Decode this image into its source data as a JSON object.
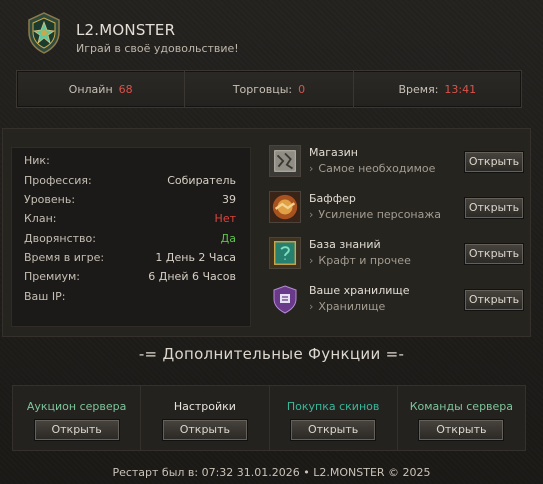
{
  "header": {
    "title": "L2.MONSTER",
    "subtitle": "Играй в своё удовольствие!"
  },
  "stats": [
    {
      "label": "Онлайн",
      "value": "68"
    },
    {
      "label": "Торговцы:",
      "value": "0"
    },
    {
      "label": "Время:",
      "value": "13:41"
    }
  ],
  "profile": {
    "rows": [
      {
        "label": "Ник:",
        "value": ""
      },
      {
        "label": "Профессия:",
        "value": "Собиратель"
      },
      {
        "label": "Уровень:",
        "value": "39"
      },
      {
        "label": "Клан:",
        "value": "Нет"
      },
      {
        "label": "Дворянство:",
        "value": "Да"
      },
      {
        "label": "Время в игре:",
        "value": "1 День 2 Часа"
      },
      {
        "label": "Премиум:",
        "value": "6 Дней 6 Часов"
      },
      {
        "label": "Ваш IP:",
        "value": ""
      }
    ]
  },
  "services": [
    {
      "name": "Магазин",
      "desc": "Самое необходимое",
      "icon": "map-scroll-icon",
      "button": "Открыть"
    },
    {
      "name": "Баффер",
      "desc": "Усиление персонажа",
      "icon": "handshake-icon",
      "button": "Открыть"
    },
    {
      "name": "База знаний",
      "desc": "Крафт и прочее",
      "icon": "book-icon",
      "button": "Открыть"
    },
    {
      "name": "Ваше хранилище",
      "desc": "Хранилище",
      "icon": "shield-crest-icon",
      "button": "Открыть"
    }
  ],
  "extra": {
    "title": "-= Дополнительные Функции =-",
    "items": [
      {
        "label": "Аукцион сервера",
        "button": "Открыть",
        "color": "#7fc59b"
      },
      {
        "label": "Настройки",
        "button": "Открыть",
        "color": "#e8e4dc"
      },
      {
        "label": "Покупка скинов",
        "button": "Открыть",
        "color": "#39b79a"
      },
      {
        "label": "Команды сервера",
        "button": "Открыть",
        "color": "#7fc59b"
      }
    ]
  },
  "footer": "Рестарт был в: 07:32 31.01.2026 • L2.MONSTER © 2025"
}
